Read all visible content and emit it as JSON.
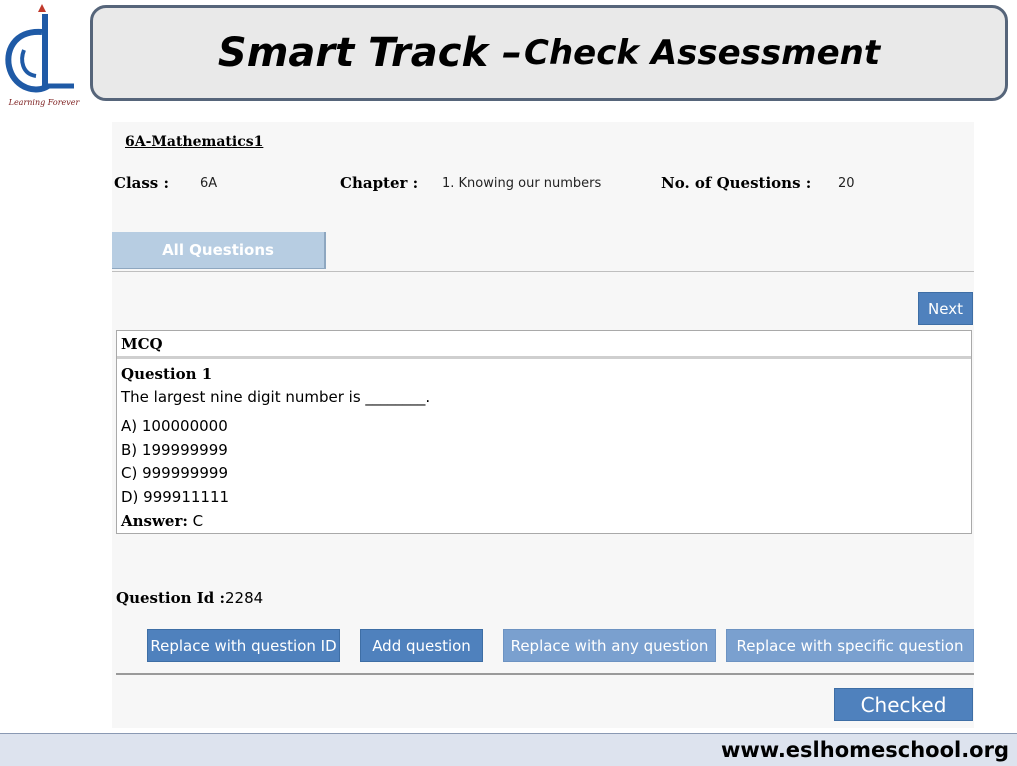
{
  "logo": {
    "icon": "esl-logo-icon",
    "caption": "Learning Forever",
    "color": "#1f5aa6"
  },
  "title": {
    "main": "Smart Track –",
    "sub": "Check Assessment"
  },
  "assessment": {
    "name": "6A-Mathematics1",
    "class_label": "Class :",
    "class_value": "6A",
    "chapter_label": "Chapter :",
    "chapter_value": "1. Knowing our numbers",
    "questions_label": "No. of  Questions :",
    "questions_value": "20"
  },
  "tabs": [
    {
      "label": "All Questions"
    }
  ],
  "nav": {
    "next_label": "Next"
  },
  "question": {
    "type": "MCQ",
    "title": "Question 1",
    "text": "The largest nine digit number is ________.",
    "options": [
      "A) 100000000",
      "B) 199999999",
      "C) 999999999",
      "D) 999911111"
    ],
    "answer_label": "Answer:",
    "answer_value": "C",
    "id_label": "Question Id :",
    "id_value": "2284"
  },
  "actions": {
    "replace_id": "Replace with question ID",
    "add": "Add question",
    "replace_any": "Replace with any question",
    "replace_specific": "Replace with specific question",
    "checked": "Checked"
  },
  "footer": {
    "url": "www.eslhomeschool.org"
  },
  "colors": {
    "button": "#4f81bd",
    "tab": "#b7cde2",
    "banner_border": "#56657a"
  }
}
